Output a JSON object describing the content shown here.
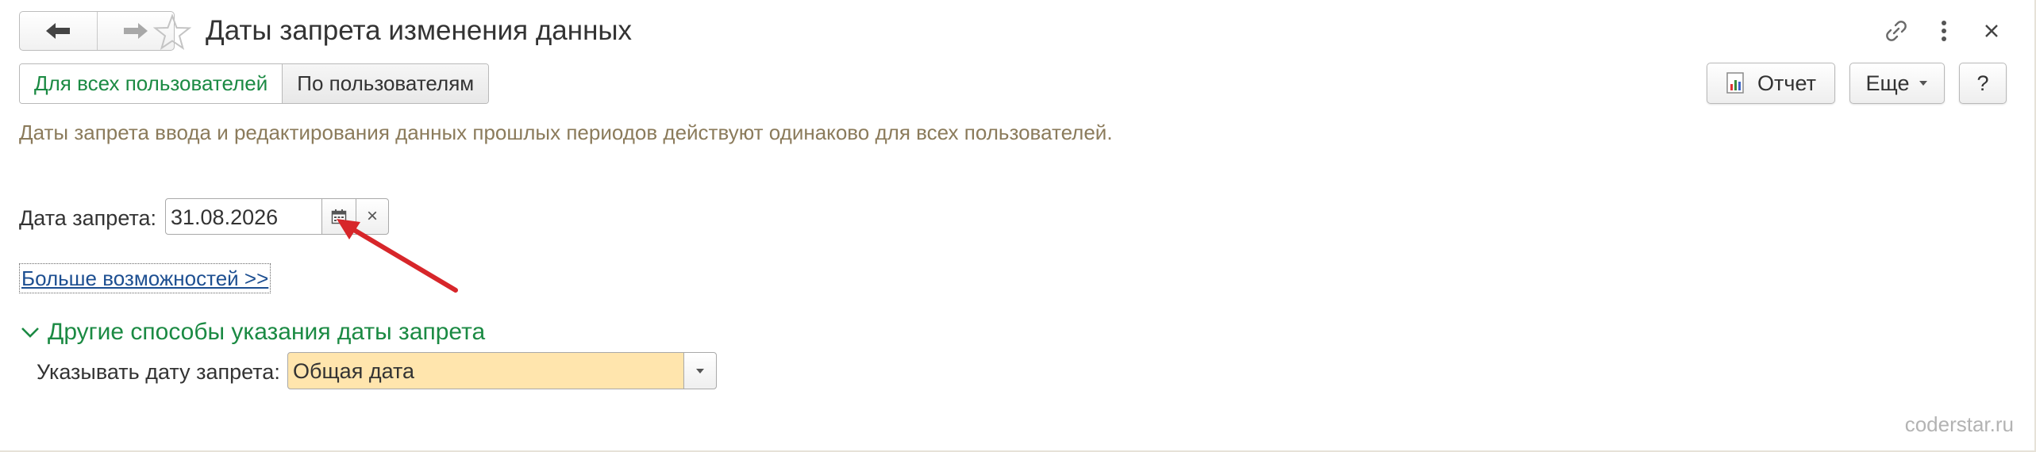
{
  "window": {
    "title": "Даты запрета изменения данных",
    "back_icon": "arrow-left-icon",
    "forward_icon": "arrow-right-icon",
    "favorite_icon": "star-icon",
    "link_icon": "link-icon",
    "menu_icon": "more-vertical-icon",
    "close_icon": "close-icon"
  },
  "tabs": [
    {
      "label": "Для всех пользователей",
      "active": true
    },
    {
      "label": "По пользователям",
      "active": false
    }
  ],
  "toolbar": {
    "report_label": "Отчет",
    "report_icon": "report-icon",
    "more_label": "Еще",
    "help_label": "?"
  },
  "info_text": "Даты запрета ввода и редактирования данных прошлых периодов действуют одинаково для всех пользователей.",
  "date_field": {
    "label": "Дата запрета:",
    "value": "31.08.2026",
    "calendar_icon": "calendar-icon",
    "clear_label": "×"
  },
  "more_link": "Больше возможностей >>",
  "other_group": {
    "title": "Другие способы указания даты запрета",
    "expanded": true,
    "field_label": "Указывать дату запрета:",
    "selected_value": "Общая дата"
  },
  "watermark": "coderstar.ru",
  "colors": {
    "accent_green": "#1b8a43",
    "info_text": "#8b7b5b",
    "link_blue": "#1d4f91",
    "select_highlight": "#ffe5ad",
    "annotation_arrow": "#d7262a"
  }
}
